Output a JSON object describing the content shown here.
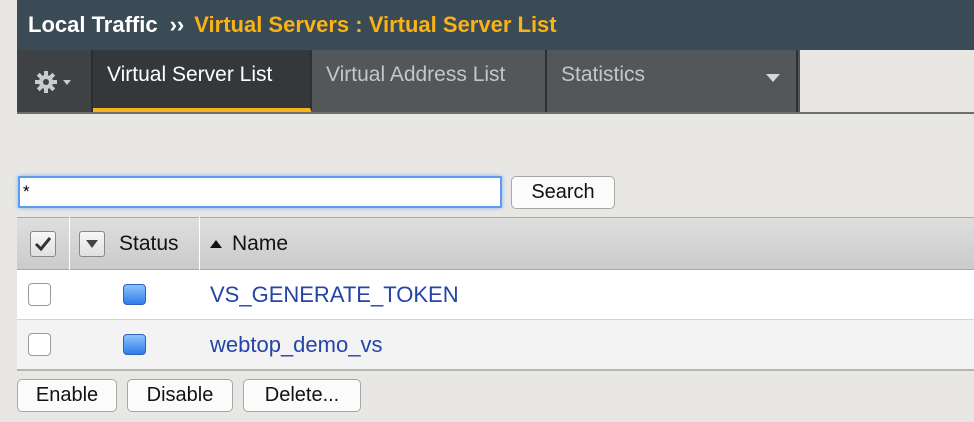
{
  "header": {
    "section": "Local Traffic",
    "separator": "››",
    "page": "Virtual Servers : Virtual Server List"
  },
  "tabs": {
    "gear_icon": "gear-icon",
    "items": [
      {
        "label": "Virtual Server List",
        "active": true
      },
      {
        "label": "Virtual Address List",
        "active": false
      },
      {
        "label": "Statistics",
        "active": false
      }
    ]
  },
  "search": {
    "value": "*",
    "button_label": "Search"
  },
  "table": {
    "columns": [
      "Status",
      "Name"
    ],
    "rows": [
      {
        "status": "blue",
        "name": "VS_GENERATE_TOKEN"
      },
      {
        "status": "blue",
        "name": "webtop_demo_vs"
      }
    ]
  },
  "actions": {
    "enable_label": "Enable",
    "disable_label": "Disable",
    "delete_label": "Delete..."
  },
  "colors": {
    "accent": "#f5b51b",
    "header_bg": "#3b4b56",
    "link": "#2544a8",
    "status_blue": "#2f7de8"
  }
}
